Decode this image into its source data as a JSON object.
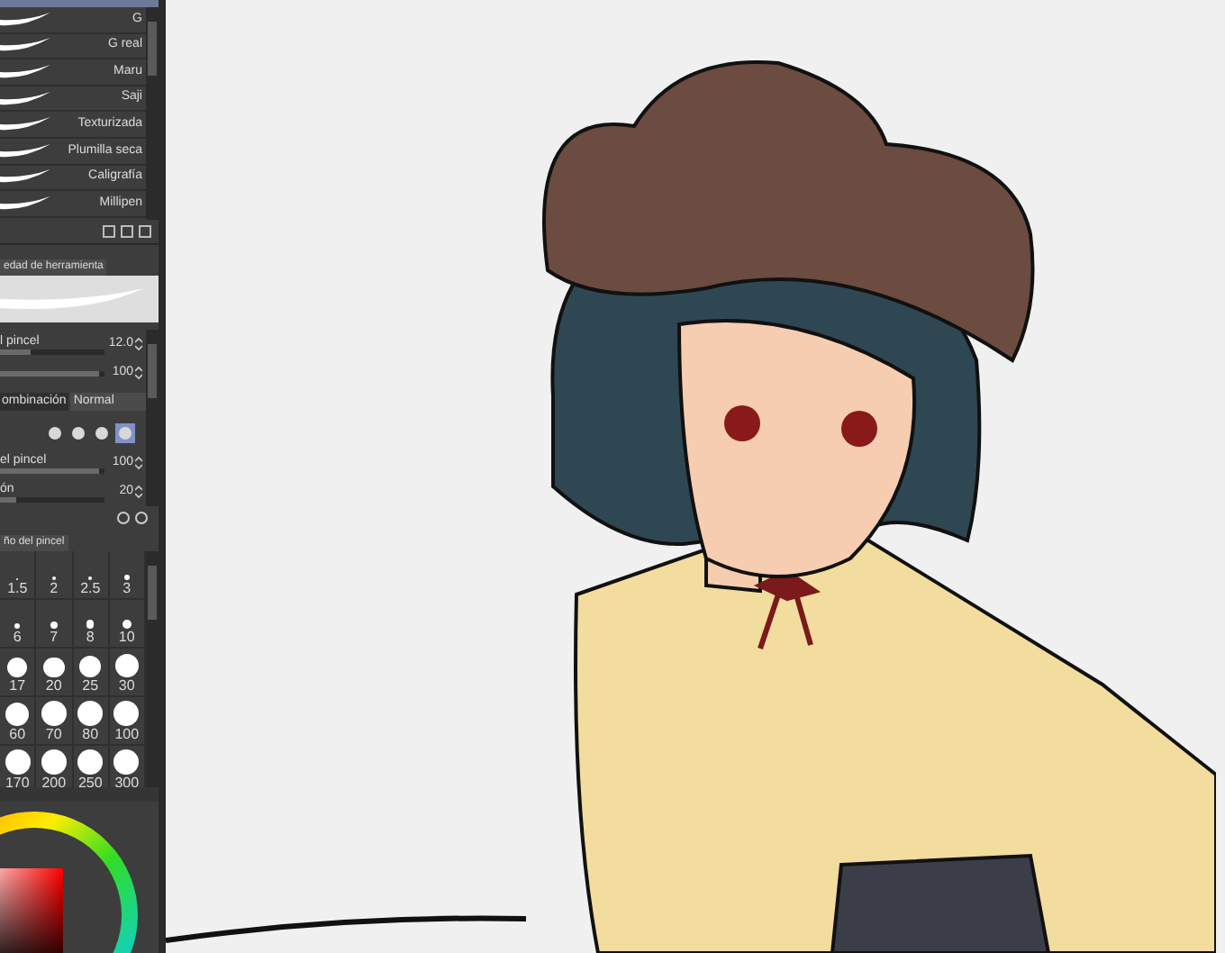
{
  "brushes": [
    {
      "name": "G"
    },
    {
      "name": "G real"
    },
    {
      "name": "Maru"
    },
    {
      "name": "Saji"
    },
    {
      "name": "Texturizada"
    },
    {
      "name": "Plumilla seca"
    },
    {
      "name": "Caligrafía"
    },
    {
      "name": "Millipen"
    }
  ],
  "tool_property": {
    "tab": "edad de herramienta",
    "rows": [
      {
        "kind": "slider",
        "label": "l pincel",
        "value": "12.0",
        "level": 0.3
      },
      {
        "kind": "slider",
        "label": "",
        "value": "100",
        "level": 0.95
      },
      {
        "kind": "select",
        "label": "ombinación",
        "value": "Normal"
      },
      {
        "kind": "tips",
        "tips": [
          {
            "selected": false
          },
          {
            "selected": false
          },
          {
            "selected": false
          },
          {
            "selected": true
          }
        ]
      },
      {
        "kind": "slider",
        "label": "el pincel",
        "value": "100",
        "level": 0.95
      },
      {
        "kind": "slider",
        "label": "ón",
        "value": "20",
        "level": 0.15
      }
    ]
  },
  "brush_size": {
    "tab": "ño del pincel",
    "sizes": [
      "1.5",
      "2",
      "2.5",
      "3",
      "6",
      "7",
      "8",
      "10",
      "17",
      "20",
      "25",
      "30",
      "60",
      "70",
      "80",
      "100",
      "170",
      "200",
      "250",
      "300"
    ]
  }
}
